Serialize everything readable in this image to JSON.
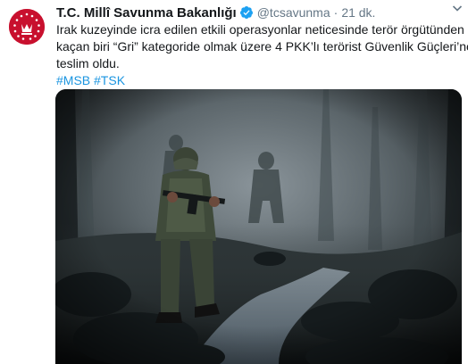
{
  "tweet": {
    "display_name": "T.C. Millî Savunma Bakanlığı",
    "handle": "@tcsavunma",
    "separator": "·",
    "time": "21 dk.",
    "lines": [
      "Irak kuzeyinde icra edilen etkili operasyonlar neticesinde terör örgütünden",
      "kaçan biri “Gri” kategoride olmak üzere  4 PKK’lı terörist Güvenlik Güçleri’ne",
      "teslim oldu."
    ],
    "hashtags": [
      "#MSB",
      "#TSK"
    ],
    "photo_alt": "Misty forest with armed soldiers walking along a rocky stream"
  },
  "icons": {
    "avatar": "ministry-emblem-icon",
    "verified": "verified-badge-icon",
    "more": "chevron-down-icon"
  },
  "colors": {
    "name": "#14171a",
    "secondary": "#657786",
    "link": "#1b95e0",
    "verified": "#1da1f2",
    "avatar_bg": "#c8102e"
  }
}
